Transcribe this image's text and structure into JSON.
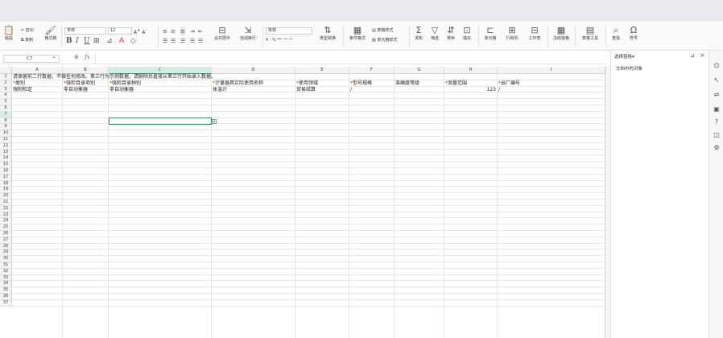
{
  "ribbon": {
    "cut": "剪切",
    "paste": "粘贴",
    "copy": "复制",
    "format_painter": "格式刷",
    "font_name": "宋体",
    "font_size": "12",
    "merge_center": "合并居中",
    "wrap_text": "自动换行",
    "number_format": "常规",
    "type_convert": "类型转换",
    "conditional_format": "条件格式",
    "table_style": "表格样式",
    "cell_style": "单元格样式",
    "sum": "求和",
    "filter": "筛选",
    "sort": "排序",
    "fill": "填充",
    "cell": "单元格",
    "row_col": "行和列",
    "worksheet": "工作表",
    "freeze": "冻结窗格",
    "table_tools": "表格工具",
    "find": "查找",
    "symbol": "符号"
  },
  "formula": {
    "cell_ref": "C7",
    "fx": "fx",
    "value": ""
  },
  "sheet": {
    "columns": [
      "A",
      "B",
      "C",
      "D",
      "E",
      "F",
      "G",
      "H",
      "I"
    ],
    "rows": [
      "1",
      "2",
      "3",
      "4",
      "5",
      "6",
      "7",
      "8",
      "9",
      "10",
      "11",
      "12",
      "13",
      "14",
      "15",
      "16",
      "17",
      "18",
      "19",
      "20",
      "21",
      "22",
      "23",
      "24",
      "25",
      "26",
      "27",
      "28",
      "29",
      "30",
      "31",
      "32",
      "33",
      "34",
      "35",
      "36",
      "37"
    ],
    "notice": "请保留前二行数据，不做任何修改。第三行为示例数据，请删除后直接从第三行开始录入数据。",
    "header_row": [
      {
        "req": "*",
        "text": "类别"
      },
      {
        "req": "*",
        "text": "强检目录项别"
      },
      {
        "req": "*",
        "text": "强检目录种别"
      },
      {
        "req": "*",
        "text": "计量器具实际使用名称"
      },
      {
        "req": "*",
        "text": "使用领域"
      },
      {
        "req": "*",
        "text": "型号规格"
      },
      {
        "req": "",
        "text": "准确度等级"
      },
      {
        "req": "*",
        "text": "测量范围"
      },
      {
        "req": "*",
        "text": "出厂编号"
      }
    ],
    "example_row": [
      "强制检定",
      "非自动衡器",
      "非自动衡器",
      "体温计",
      "贸易结算",
      "/",
      "",
      "123",
      "/"
    ],
    "selected_column": "C",
    "selected_row": "7"
  },
  "panel": {
    "title": "选择窗格",
    "title_suffix": "▾",
    "section": "文档中的对象"
  },
  "icons": {
    "close": "×",
    "pin": "⊿"
  }
}
